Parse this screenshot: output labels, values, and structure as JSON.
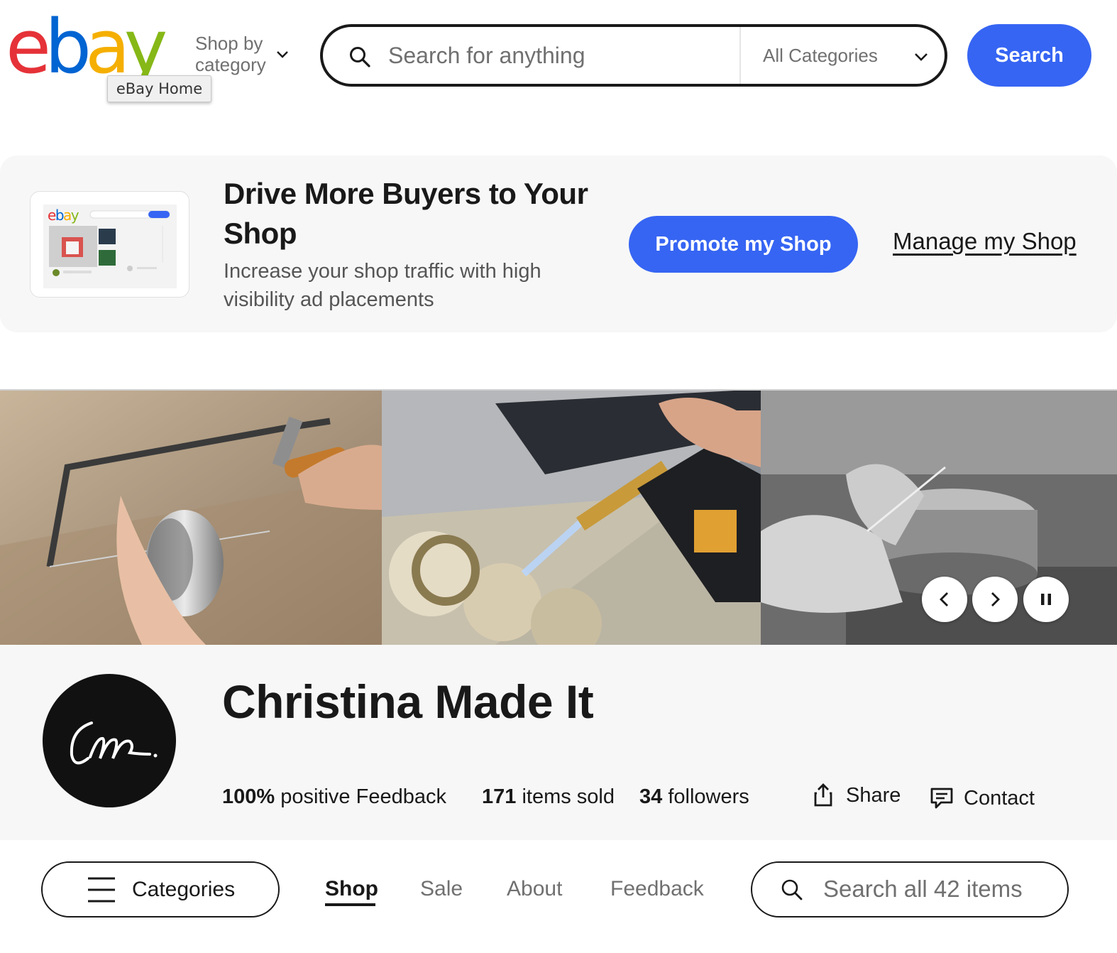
{
  "header": {
    "logo_text": "ebay",
    "logo_tooltip": "eBay Home",
    "shop_by_category": "Shop by category",
    "search_placeholder": "Search for anything",
    "category_select": "All Categories",
    "search_button": "Search",
    "colors": {
      "brand_red": "#e53238",
      "brand_blue": "#0064d2",
      "brand_yellow": "#f5af02",
      "brand_green": "#86b817",
      "accent": "#3665f3"
    }
  },
  "promo": {
    "title": "Drive More Buyers to Your Shop",
    "subtitle": "Increase your shop traffic with high visibility ad placements",
    "promote_button": "Promote my Shop",
    "manage_link": "Manage my Shop",
    "thumb_logo": "ebay"
  },
  "hero": {
    "images": [
      "jeweler-sawing-ring",
      "torch-soldering-ring",
      "hands-shaping-ring"
    ],
    "controls": {
      "prev_icon": "chevron-left-icon",
      "next_icon": "chevron-right-icon",
      "pause_icon": "pause-icon"
    }
  },
  "shop": {
    "name": "Christina Made It",
    "avatar_text": "Cm.",
    "feedback_value": "100%",
    "feedback_label": "positive Feedback",
    "items_sold_value": "171",
    "items_sold_label": "items sold",
    "followers_value": "34",
    "followers_label": "followers",
    "share_label": "Share",
    "contact_label": "Contact"
  },
  "nav": {
    "categories_button": "Categories",
    "tabs": [
      "Shop",
      "Sale",
      "About",
      "Feedback"
    ],
    "active_tab": "Shop",
    "search_placeholder": "Search all 42 items"
  }
}
